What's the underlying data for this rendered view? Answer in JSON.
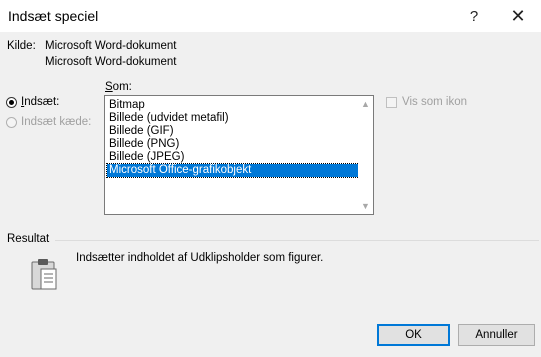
{
  "dialog": {
    "title": "Indsæt speciel",
    "help_glyph": "?",
    "close_glyph": "✕"
  },
  "source": {
    "label": "Kilde:",
    "line1": "Microsoft Word-dokument",
    "line2": "Microsoft Word-dokument"
  },
  "som_label_first": "S",
  "som_label_rest": "om:",
  "options": {
    "paste_first": "I",
    "paste_rest": "ndsæt:",
    "paste_checked": true,
    "paste_link": "Indsæt kæde:",
    "paste_link_enabled": false
  },
  "list": {
    "items": [
      "Bitmap",
      "Billede (udvidet metafil)",
      "Billede (GIF)",
      "Billede (PNG)",
      "Billede (JPEG)",
      "Microsoft Office-grafikobjekt"
    ],
    "selected_index": 5
  },
  "display_as_icon": {
    "label": "Vis som ikon",
    "checked": false,
    "enabled": false
  },
  "result": {
    "label": "Resultat",
    "text": "Indsætter indholdet af Udklipsholder som figurer.",
    "icon": "clipboard-icon"
  },
  "buttons": {
    "ok": "OK",
    "cancel": "Annuller"
  },
  "colors": {
    "selection": "#0078d7",
    "background": "#f0f0f0"
  }
}
